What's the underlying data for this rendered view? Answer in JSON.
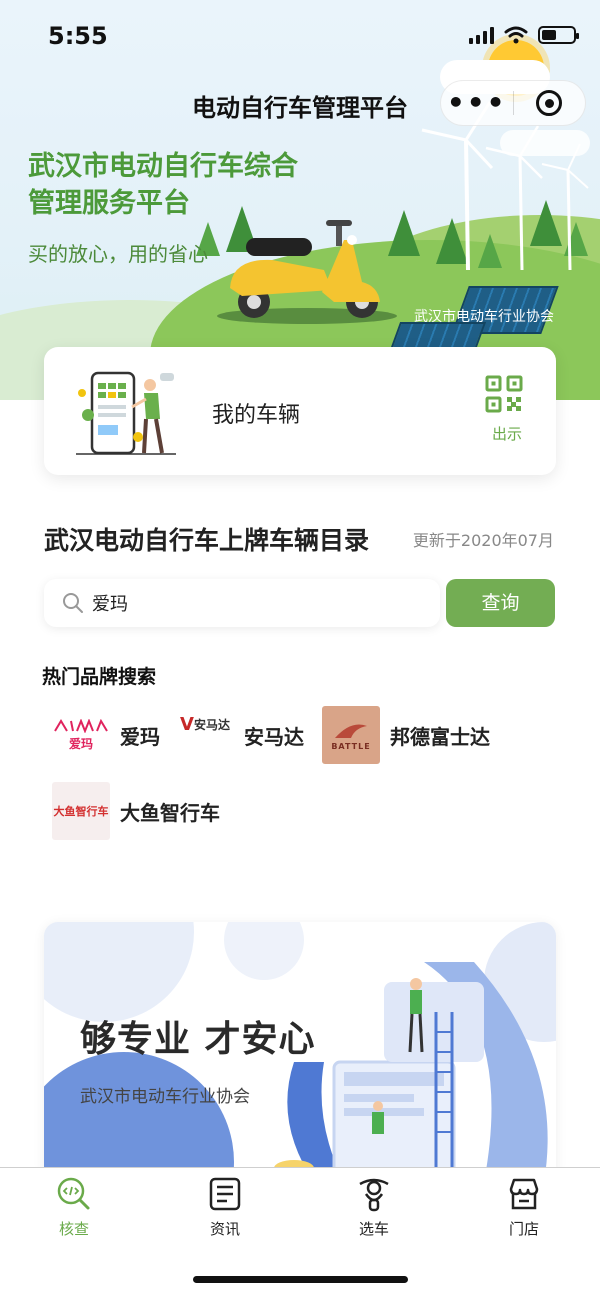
{
  "status_bar": {
    "time": "5:55"
  },
  "nav": {
    "title": "电动自行车管理平台",
    "more_label": "•••"
  },
  "hero": {
    "heading_line1": "武汉市电动自行车综合",
    "heading_line2": "管理服务平台",
    "slogan": "买的放心，用的省心",
    "association": "武汉市电动车行业协会"
  },
  "vehicle_card": {
    "label": "我的车辆",
    "qr_label": "出示"
  },
  "catalog": {
    "title": "武汉电动自行车上牌车辆目录",
    "updated": "更新于2020年07月",
    "search_value": "爱玛",
    "search_button": "查询"
  },
  "hot_brands": {
    "title": "热门品牌搜索",
    "items": [
      {
        "name": "爱玛",
        "logo_text": "爱玛",
        "logo_mark": "AIMA"
      },
      {
        "name": "安马达",
        "logo_text": "安马达",
        "logo_mark": "V"
      },
      {
        "name": "邦德富士达",
        "logo_text": "BATTLE"
      },
      {
        "name": "大鱼智行车",
        "logo_text": "大鱼智行车"
      }
    ]
  },
  "promo": {
    "heading": "够专业 才安心",
    "subheading": "武汉市电动车行业协会"
  },
  "tabbar": {
    "tabs": [
      {
        "label": "核查",
        "icon": "check-code-icon"
      },
      {
        "label": "资讯",
        "icon": "news-icon"
      },
      {
        "label": "选车",
        "icon": "scooter-icon"
      },
      {
        "label": "门店",
        "icon": "store-icon"
      }
    ],
    "active": 0
  },
  "colors": {
    "brand_green": "#73ad53",
    "hero_text_green": "#4c9a3a",
    "active_tab": "#6aaa4a"
  }
}
